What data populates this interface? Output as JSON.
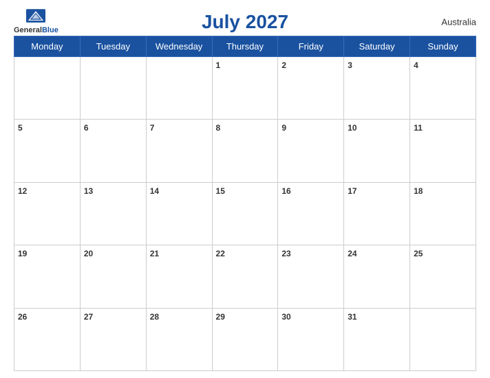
{
  "header": {
    "title": "July 2027",
    "country": "Australia",
    "logo_general": "General",
    "logo_blue": "Blue"
  },
  "weekdays": [
    "Monday",
    "Tuesday",
    "Wednesday",
    "Thursday",
    "Friday",
    "Saturday",
    "Sunday"
  ],
  "weeks": [
    [
      null,
      null,
      null,
      1,
      2,
      3,
      4
    ],
    [
      5,
      6,
      7,
      8,
      9,
      10,
      11
    ],
    [
      12,
      13,
      14,
      15,
      16,
      17,
      18
    ],
    [
      19,
      20,
      21,
      22,
      23,
      24,
      25
    ],
    [
      26,
      27,
      28,
      29,
      30,
      31,
      null
    ]
  ]
}
